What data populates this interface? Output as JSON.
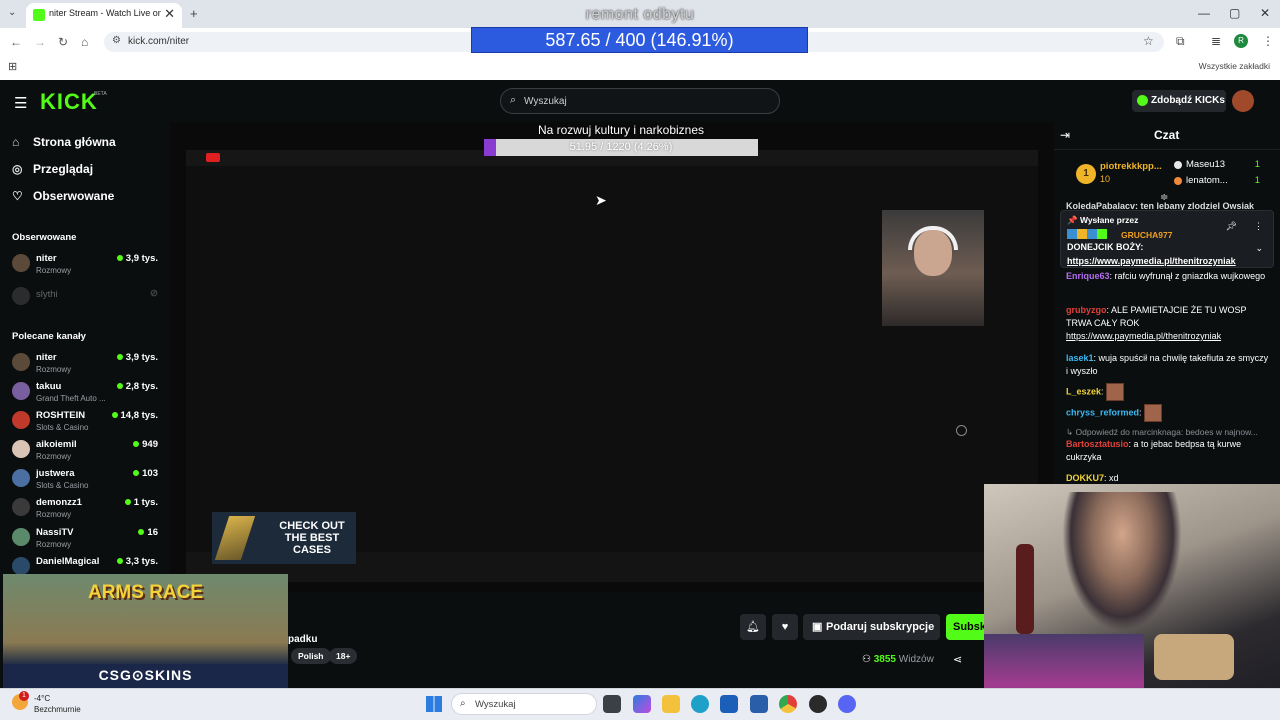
{
  "browser": {
    "tab_title": "niter Stream - Watch Live on Kick",
    "tab_close": "✕",
    "new_tab": "+",
    "url": "kick.com/niter",
    "profile_initial": "R",
    "bookmarks_label": "Wszystkie zakładki"
  },
  "overlay": {
    "goal_title": "remont odbytu",
    "goal_progress": "587.65 / 400 (146.91%)",
    "goal_fraction": 1.4691,
    "subgoal_title": "Na rozwuj kultury i narkobiznes",
    "subgoal_progress": "51.95 / 1220 (4.26%)",
    "subgoal_fraction": 0.0426,
    "ad_text": "CHECK OUT THE BEST CASES",
    "skins_headline": "ARMS RACE",
    "skins_brand": "CSG⊙SKINS"
  },
  "header": {
    "logo": "KICK",
    "logo_badge": "BETA",
    "search_placeholder": "Wyszukaj",
    "kicks_button": "Zdobądź KICKs"
  },
  "sidebar": {
    "nav": [
      {
        "icon": "home-icon",
        "glyph": "⌂",
        "label": "Strona główna"
      },
      {
        "icon": "compass-icon",
        "glyph": "◎",
        "label": "Przeglądaj"
      },
      {
        "icon": "heart-icon",
        "glyph": "♡",
        "label": "Obserwowane"
      }
    ],
    "followed_title": "Obserwowane",
    "followed": [
      {
        "name": "niter",
        "category": "Rozmowy",
        "viewers": "3,9 tys."
      },
      {
        "name": "slythi",
        "category": "",
        "viewers": ""
      }
    ],
    "recommended_title": "Polecane kanały",
    "recommended": [
      {
        "name": "niter",
        "category": "Rozmowy",
        "viewers": "3,9 tys."
      },
      {
        "name": "takuu",
        "category": "Grand Theft Auto ...",
        "viewers": "2,8 tys."
      },
      {
        "name": "ROSHTEIN",
        "category": "Slots & Casino",
        "viewers": "14,8 tys."
      },
      {
        "name": "aikoiemil",
        "category": "Rozmowy",
        "viewers": "949"
      },
      {
        "name": "justwera",
        "category": "Slots & Casino",
        "viewers": "103"
      },
      {
        "name": "demonzz1",
        "category": "Rozmowy",
        "viewers": "1 tys."
      },
      {
        "name": "NassiTV",
        "category": "Rozmowy",
        "viewers": "16"
      },
      {
        "name": "DanielMagical",
        "category": "",
        "viewers": "3,3 tys."
      }
    ]
  },
  "stream": {
    "title_fragment": "padku",
    "tags": [
      "Polish",
      "18+"
    ],
    "gift_button": "Podaruj subskrypcje",
    "subscribe_button": "Subskrybuj",
    "viewers_count": "3855",
    "viewers_label": "Widzów"
  },
  "chat": {
    "title": "Czat",
    "leaderboard": {
      "first": {
        "rank": "1",
        "name": "piotrekkkpp...",
        "count": "10"
      },
      "others": [
        {
          "name": "Maseu13",
          "count": "1",
          "color": "#e8e8e8"
        },
        {
          "name": "lenatom...",
          "count": "1",
          "color": "#f08a3a"
        }
      ]
    },
    "cutoff_text": "KoledaPabalacv: ten lebany zlodziel Owsiak",
    "pinned": {
      "by_label": "📌 Wysłane przez",
      "user": "GRUCHA977",
      "message": "DONEJCIK BOŻY:",
      "link": "https://www.paymedia.pl/thenitrozyniak"
    },
    "messages": [
      {
        "user": "Enrique63",
        "color": "#b46cf0",
        "text": "rafciu wyfrunął z gniazdka wujkowego",
        "link": ""
      },
      {
        "user": "grubyzgo",
        "color": "#e0403a",
        "text": "ALE PAMIETAJCIE ŻE TU WOSP TRWA CAŁY ROK",
        "link": "https://www.paymedia.pl/thenitrozyniak"
      },
      {
        "user": "lasek1",
        "color": "#3ab8f0",
        "text": "wuja spuścił na chwilę takefiuta ze smyczy i wyszło",
        "link": ""
      },
      {
        "user": "L_eszek",
        "color": "#f0d23a",
        "text": "",
        "link": ""
      },
      {
        "user": "chryss_reformed",
        "color": "#3ab8f0",
        "text": "",
        "link": ""
      },
      {
        "user": "Bartosztatusio",
        "color": "#e0403a",
        "text": "a to jebac bedpsa tą kurwe cukrzyka",
        "link": ""
      },
      {
        "user": "DOKKU7",
        "color": "#f0d23a",
        "text": "xd",
        "link": ""
      }
    ],
    "reply_text": "↳ Odpowiedź do marcinknaga: bedoes w najnow..."
  },
  "taskbar": {
    "weather_badge": "1",
    "temp": "-4°C",
    "weather": "Bezchmurnie",
    "search_placeholder": "Wyszukaj"
  }
}
